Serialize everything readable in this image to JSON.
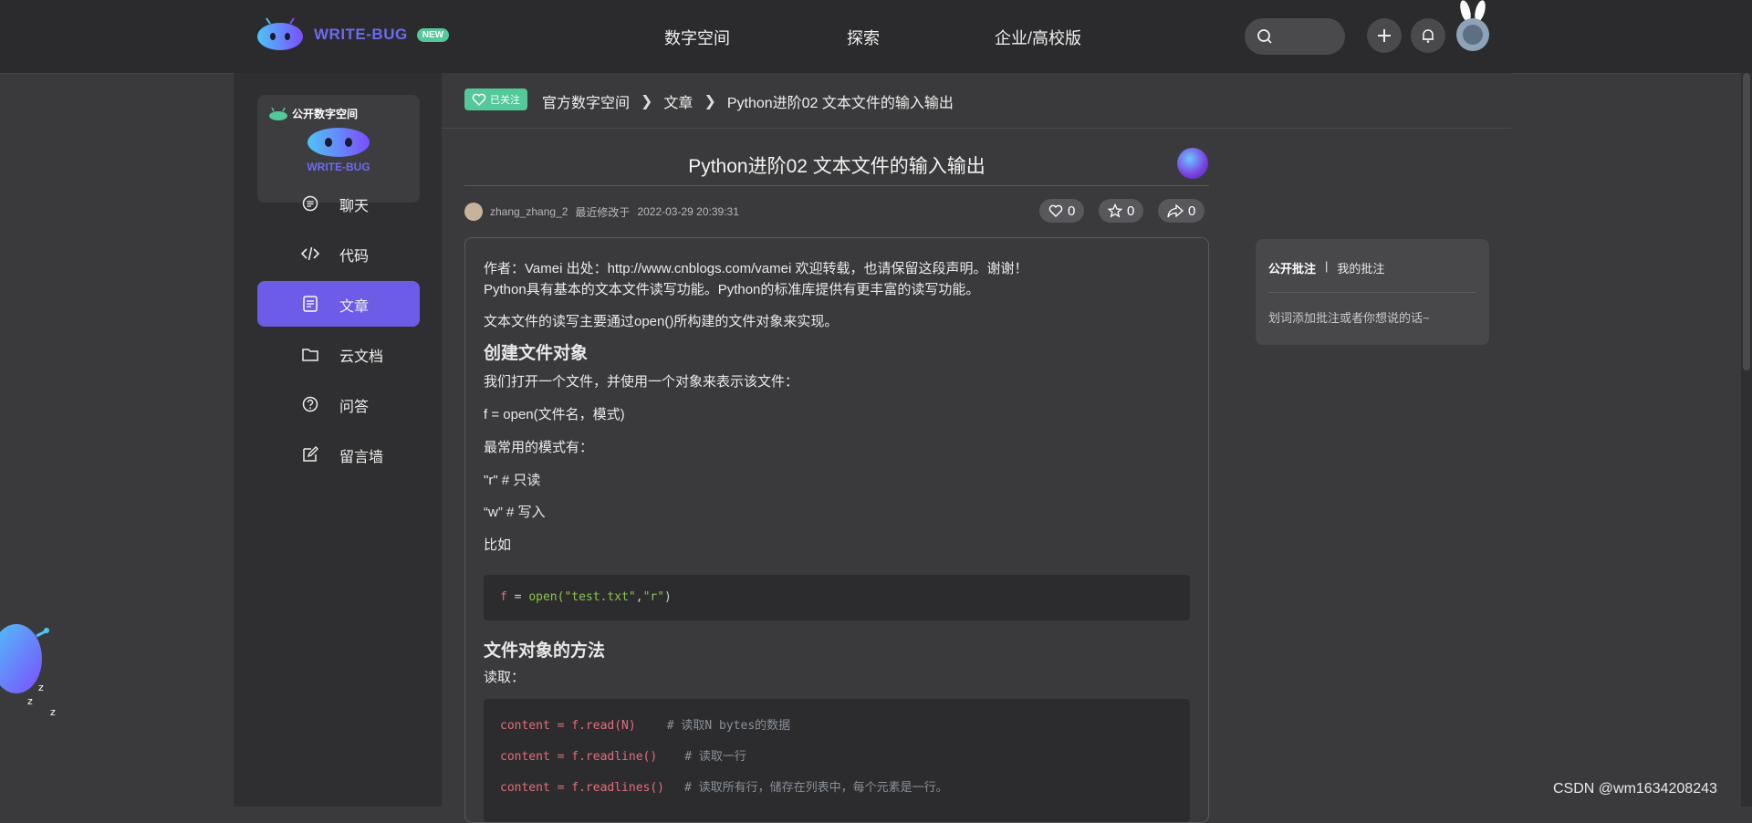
{
  "header": {
    "logo_text": "WRITE-BUG",
    "new_badge": "NEW",
    "nav": [
      "数字空间",
      "探索",
      "企业/高校版"
    ]
  },
  "sidebar": {
    "space_badge": "公开数字空间",
    "space_logo_text": "WRITE-BUG",
    "items": [
      {
        "label": "聊天",
        "icon": "chat-icon"
      },
      {
        "label": "代码",
        "icon": "code-icon"
      },
      {
        "label": "文章",
        "icon": "article-icon",
        "active": true
      },
      {
        "label": "云文档",
        "icon": "folder-icon"
      },
      {
        "label": "问答",
        "icon": "question-icon"
      },
      {
        "label": "留言墙",
        "icon": "edit-icon"
      }
    ]
  },
  "breadcrumb": {
    "follow_label": "已关注",
    "items": [
      "官方数字空间",
      "文章",
      "Python进阶02 文本文件的输入输出"
    ]
  },
  "article": {
    "title": "Python进阶02 文本文件的输入输出",
    "author": "zhang_zhang_2",
    "modified_label": "最近修改于",
    "modified_time": "2022-03-29 20:39:31",
    "likes": "0",
    "favorites": "0",
    "shares": "0",
    "p1": "作者：Vamei 出处：http://www.cnblogs.com/vamei 欢迎转载，也请保留这段声明。谢谢！",
    "p2": "Python具有基本的文本文件读写功能。Python的标准库提供有更丰富的读写功能。",
    "p3": "文本文件的读写主要通过open()所构建的文件对象来实现。",
    "h1": "创建文件对象",
    "p4": "我们打开一个文件，并使用一个对象来表示该文件：",
    "p5": "f = open(文件名，模式)",
    "p6": "最常用的模式有：",
    "p7": "\"r\" # 只读",
    "p8": "“w” # 写入",
    "p9": "比如",
    "code1": {
      "a": "f",
      "b": " = ",
      "c": "open(",
      "d": "\"test.txt\"",
      "e": ",",
      "f": "\"r\"",
      "g": ")"
    },
    "h2": "文件对象的方法",
    "p10": "读取：",
    "code2": [
      {
        "code": "content = f.read(N)",
        "comment": "# 读取N bytes的数据"
      },
      {
        "code": "content = f.readline()",
        "comment": "# 读取一行"
      },
      {
        "code": "content = f.readlines()",
        "comment": "# 读取所有行，储存在列表中，每个元素是一行。"
      }
    ]
  },
  "annotations": {
    "tab_public": "公开批注",
    "separator": "|",
    "tab_mine": "我的批注",
    "hint": "划词添加批注或者你想说的话~"
  },
  "watermark": "CSDN @wm1634208243",
  "colors": {
    "accent": "#6c5ce7",
    "green": "#54c89a",
    "brand": "#6b6cf0"
  }
}
